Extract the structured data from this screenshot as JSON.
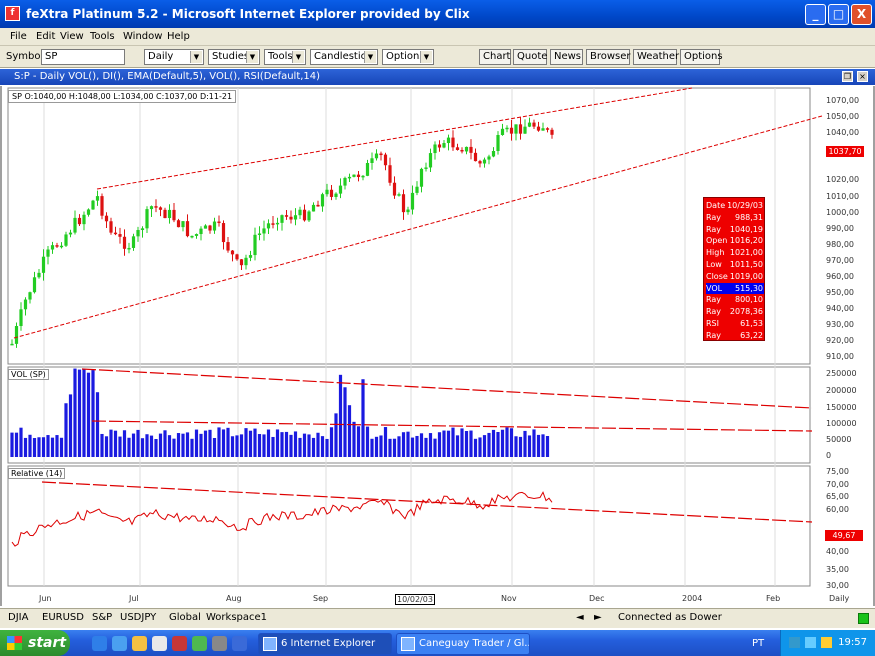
{
  "window": {
    "title": "feXtra Platinum 5.2 - Microsoft Internet Explorer provided by Clix",
    "app_icon": "feXtra-icon",
    "buttons": [
      "_",
      "□",
      "X"
    ]
  },
  "menu": [
    "File",
    "Edit",
    "View",
    "Tools",
    "Window",
    "Help"
  ],
  "toolbar": {
    "symbol_label": "Symbol",
    "symbol_value": "SP",
    "period": "Daily",
    "studies": "Studies",
    "tools": "Tools",
    "candlestick": "Candlestick",
    "options_dd": "Options",
    "buttons": [
      "Chart",
      "Quote",
      "News",
      "Browser",
      "Weather",
      "Options"
    ]
  },
  "chart_window": {
    "title": "S:P - Daily VOL(), DI(), EMA(Default,5), VOL(), RSI(Default,14)",
    "ohlc_bar": "SP  O:1040,00  H:1048,00  L:1034,00  C:1037,00  D:11-21"
  },
  "price_axis": [
    "1070,00",
    "1050,00",
    "1040,00",
    "1037,70",
    "1020,00",
    "1010,00",
    "1000,00",
    "990,00",
    "980,00",
    "970,00",
    "960,00",
    "950,00",
    "940,00",
    "930,00",
    "920,00",
    "910,00"
  ],
  "last_price": "1037,70",
  "volume_panel": {
    "label": "VOL (SP)",
    "axis": [
      "250000",
      "200000",
      "150000",
      "100000",
      "50000",
      "0"
    ]
  },
  "rsi_panel": {
    "label": "Relative (14)",
    "axis": [
      "75,00",
      "70,00",
      "65,00",
      "60,00",
      "49,67",
      "40,00",
      "35,00",
      "30,00"
    ],
    "last": "49,67"
  },
  "x_axis": [
    "Jun",
    "Jul",
    "Aug",
    "Sep",
    "10/02/03",
    "Nov",
    "Dec",
    "2004",
    "Feb",
    "Daily"
  ],
  "info_box": [
    {
      "k": "Date",
      "v": "10/29/03"
    },
    {
      "k": "Ray",
      "v": "988,31"
    },
    {
      "k": "Ray",
      "v": "1040,19"
    },
    {
      "k": "Open",
      "v": "1016,20"
    },
    {
      "k": "High",
      "v": "1021,00"
    },
    {
      "k": "Low",
      "v": "1011,50"
    },
    {
      "k": "Close",
      "v": "1019,00"
    },
    {
      "k": "VOL",
      "v": "515,30"
    },
    {
      "k": "Ray",
      "v": "800,10"
    },
    {
      "k": "Ray",
      "v": "2078,36"
    },
    {
      "k": "RSI",
      "v": "61,53"
    },
    {
      "k": "Ray",
      "v": "63,22"
    }
  ],
  "bottom_tabs": [
    "DJIA",
    "EURUSD",
    "S&P",
    "USDJPY",
    "Global",
    "Workspace1"
  ],
  "status": "Connected as Dower",
  "taskbar": {
    "start": "start",
    "tasks": [
      "6 Internet Explorer",
      "Caneguay Trader / Gl..."
    ],
    "lang": "PT",
    "clock": "19:57"
  },
  "colors": {
    "up": "#22cc22",
    "down": "#dd1111",
    "trend": "#dd0000",
    "volume": "#1a1ae0",
    "rsi": "#dd0000"
  }
}
